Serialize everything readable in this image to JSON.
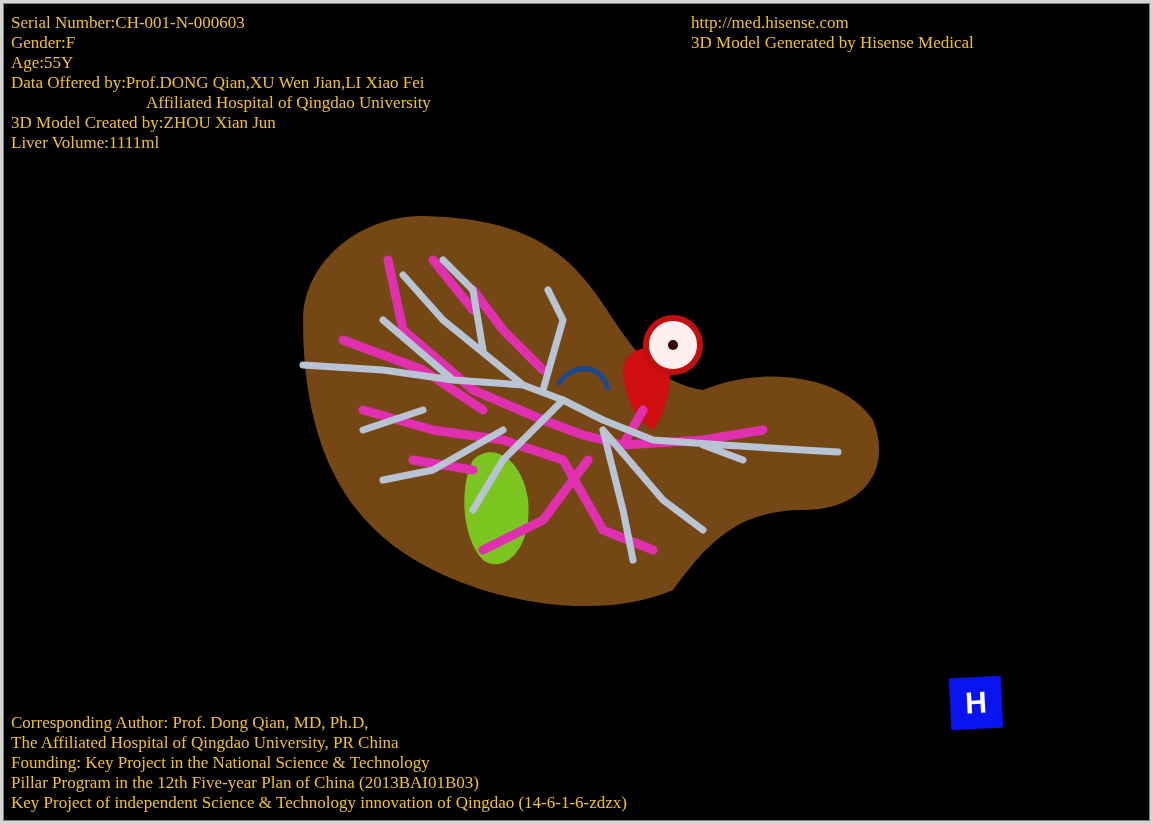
{
  "patient_info": [
    {
      "text": "Serial Number:CH-001-N-000603",
      "kind": "plain"
    },
    {
      "text": "Gender:F",
      "kind": "plain"
    },
    {
      "text": "Age:55Y",
      "kind": "plain"
    },
    {
      "text": "Data Offered by:Prof.DONG Qian,XU Wen Jian,LI Xiao Fei",
      "kind": "plain"
    },
    {
      "text": "Affiliated Hospital of Qingdao University",
      "kind": "indented"
    },
    {
      "text": "3D Model Created by:ZHOU Xian Jun",
      "kind": "plain"
    },
    {
      "text": "Liver Volume:1111ml",
      "kind": "plain"
    }
  ],
  "vendor_info": [
    "http://med.hisense.com",
    "3D Model Generated by Hisense Medical"
  ],
  "credits": [
    "Corresponding Author: Prof. Dong Qian, MD, Ph.D,",
    "The Affiliated Hospital of Qingdao University, PR China",
    "Founding: Key Project in the National Science & Technology",
    "Pillar Program in the 12th Five-year Plan of China (2013BAI01B03)",
    "Key Project of independent Science & Technology innovation of Qingdao (14-6-1-6-zdzx)"
  ],
  "orientation_marker": {
    "label": "H"
  }
}
